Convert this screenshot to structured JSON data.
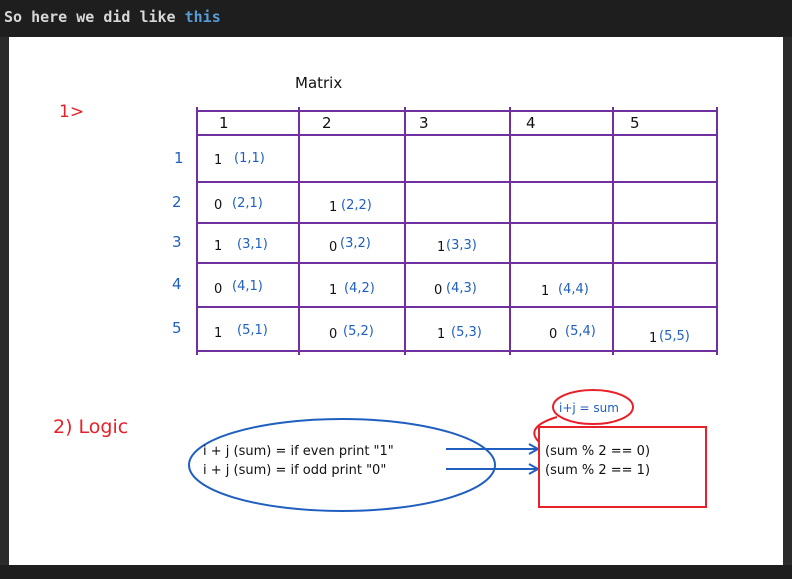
{
  "header": {
    "text_plain": "So here we did like ",
    "text_keyword": "this"
  },
  "note": {
    "section1_marker": "1>",
    "matrix_title": "Matrix",
    "column_headers": [
      "1",
      "2",
      "3",
      "4",
      "5"
    ],
    "row_labels": [
      "1",
      "2",
      "3",
      "4",
      "5"
    ],
    "cells": [
      [
        {
          "value": "1",
          "coord": "(1,1)"
        },
        null,
        null,
        null,
        null
      ],
      [
        {
          "value": "0",
          "coord": "(2,1)"
        },
        {
          "value": "1",
          "coord": "(2,2)"
        },
        null,
        null,
        null
      ],
      [
        {
          "value": "1",
          "coord": "(3,1)"
        },
        {
          "value": "0",
          "coord": "(3,2)"
        },
        {
          "value": "1",
          "coord": "(3,3)"
        },
        null,
        null
      ],
      [
        {
          "value": "0",
          "coord": "(4,1)"
        },
        {
          "value": "1",
          "coord": "(4,2)"
        },
        {
          "value": "0",
          "coord": "(4,3)"
        },
        {
          "value": "1",
          "coord": "(4,4)"
        },
        null
      ],
      [
        {
          "value": "1",
          "coord": "(5,1)"
        },
        {
          "value": "0",
          "coord": "(5,2)"
        },
        {
          "value": "1",
          "coord": "(5,3)"
        },
        {
          "value": "0",
          "coord": "(5,4)"
        },
        {
          "value": "1",
          "coord": "(5,5)"
        }
      ]
    ],
    "section2_label": "2) Logic",
    "logic_line_even": "i + j (sum) = if even print \"1\"",
    "logic_line_odd": "i + j (sum) = if odd  print \"0\"",
    "sum_note": "i+j = sum",
    "condition_even": "(sum % 2 == 0)",
    "condition_odd": "(sum % 2 == 1)"
  },
  "colors": {
    "grid": "#7030a0",
    "red_ink": "#e8202a",
    "blue_ink": "#1f5fbf",
    "black_ink": "#111111",
    "header_keyword": "#569cd6"
  }
}
